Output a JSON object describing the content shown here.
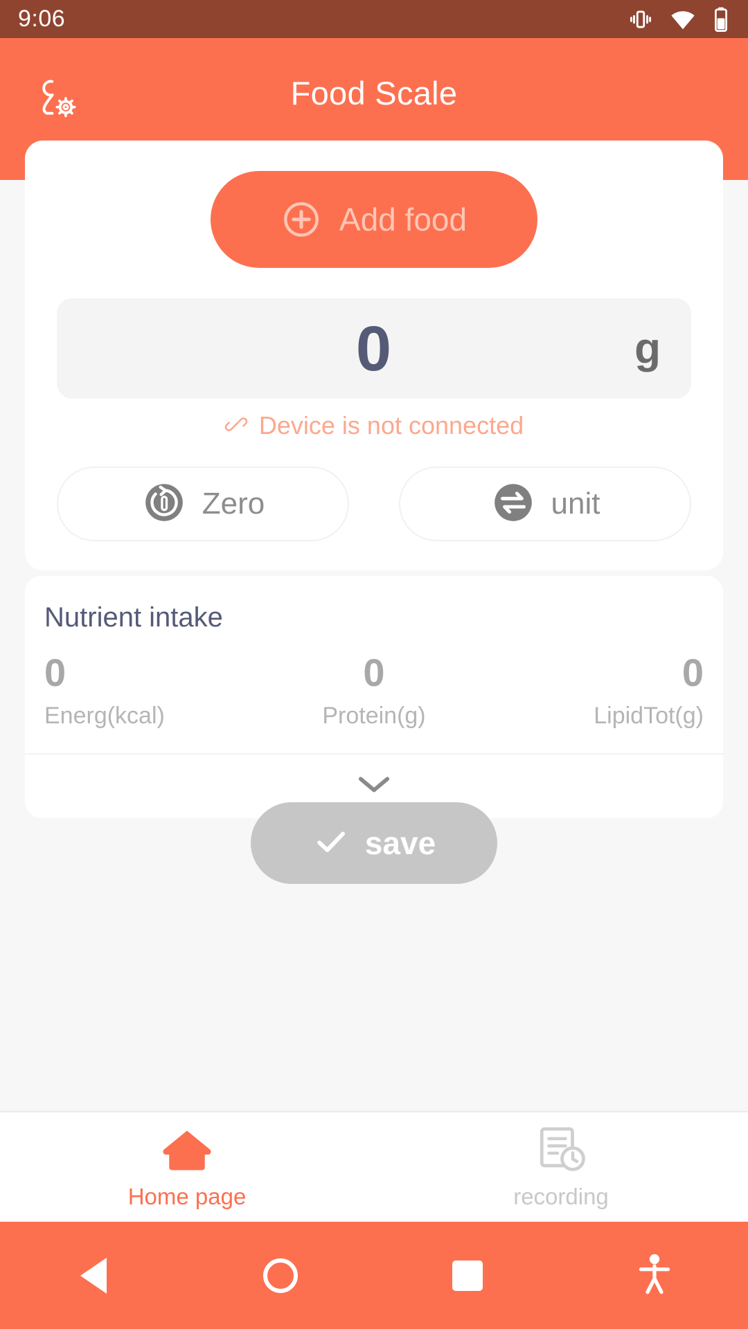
{
  "statusbar": {
    "time": "9:06",
    "icons": [
      "vibrate-icon",
      "wifi-icon",
      "battery-icon"
    ]
  },
  "header": {
    "title": "Food Scale",
    "profile_icon": "user-settings-icon"
  },
  "scale": {
    "add_food": {
      "label": "Add food",
      "icon": "plus-circle-icon"
    },
    "weight": {
      "value": "0",
      "unit": "g"
    },
    "connection": {
      "icon": "broken-link-icon",
      "text": "Device is not connected"
    },
    "actions": [
      {
        "label": "Zero",
        "icon": "tare-reset-icon"
      },
      {
        "label": "unit",
        "icon": "swap-arrows-icon"
      }
    ]
  },
  "nutrient": {
    "heading": "Nutrient intake",
    "items": [
      {
        "value": "0",
        "label": "Energ(kcal)"
      },
      {
        "value": "0",
        "label": "Protein(g)"
      },
      {
        "value": "0",
        "label": "LipidTot(g)"
      }
    ],
    "expand_icon": "chevron-down-icon"
  },
  "save": {
    "label": "save",
    "icon": "check-icon"
  },
  "bottom_nav": [
    {
      "label": "Home page",
      "icon": "home-icon",
      "active": true
    },
    {
      "label": "recording",
      "icon": "record-list-icon",
      "active": false
    }
  ],
  "android_nav": {
    "back": "back-triangle-icon",
    "home": "home-circle-icon",
    "recents": "recents-square-icon",
    "accessibility": "accessibility-icon"
  },
  "colors": {
    "accent": "#fc7050",
    "statusbar": "#8f4430",
    "text_dark": "#555a77",
    "text_muted": "#b5b5b5",
    "disabled": "#c6c6c6",
    "connection_warning": "#fca88e"
  }
}
